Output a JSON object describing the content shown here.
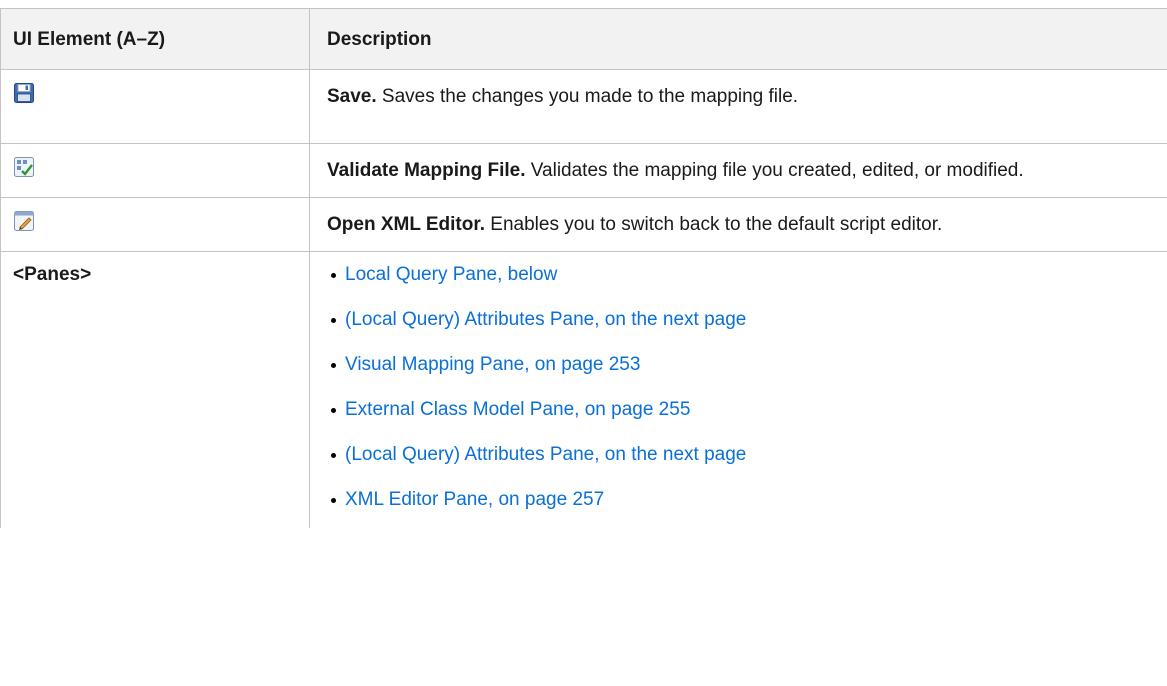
{
  "header": {
    "col1": "UI Element (A–Z)",
    "col2": "Description"
  },
  "rows": [
    {
      "icon": "save-icon",
      "title": "Save.",
      "text": " Saves the changes you made to the mapping file."
    },
    {
      "icon": "validate-mapping-icon",
      "title": "Validate Mapping File.",
      "text": " Validates the mapping file you created, edited, or modified."
    },
    {
      "icon": "open-xml-editor-icon",
      "title": "Open XML Editor.",
      "text": " Enables you to switch back to the default script editor."
    }
  ],
  "panes": {
    "label": "<Panes>",
    "links": [
      "Local Query Pane, below",
      "(Local Query) Attributes Pane, on the next page",
      "Visual Mapping Pane, on page 253",
      "External Class Model Pane, on page 255",
      "(Local Query) Attributes Pane, on the next page",
      "XML Editor Pane, on page 257"
    ]
  },
  "colors": {
    "link": "#0a6fd6",
    "header_bg": "#f2f2f2",
    "border": "#c4c4c4"
  }
}
